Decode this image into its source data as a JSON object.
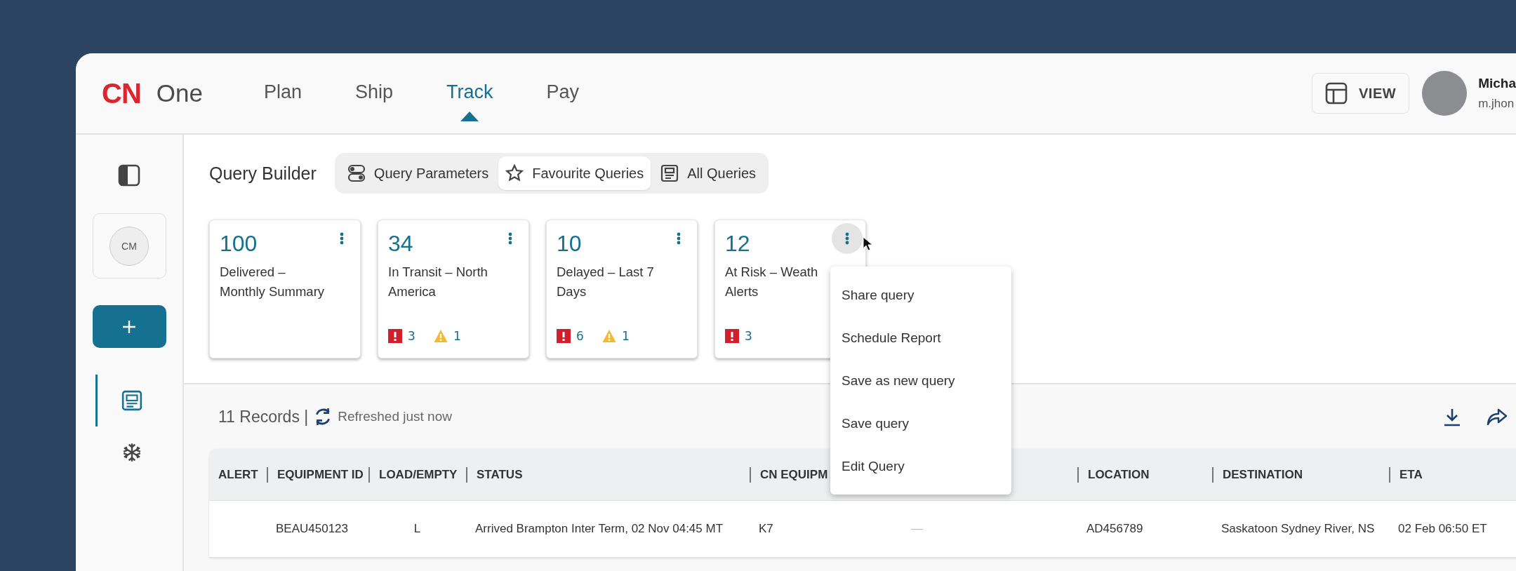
{
  "brand": {
    "logo": "CN",
    "name": "One"
  },
  "nav": [
    {
      "label": "Plan",
      "selected": false
    },
    {
      "label": "Ship",
      "selected": false
    },
    {
      "label": "Track",
      "selected": true
    },
    {
      "label": "Pay",
      "selected": false
    }
  ],
  "view_button": {
    "label": "VIEW"
  },
  "user": {
    "name": "Micha",
    "email": "m.jhon"
  },
  "sidebar": {
    "avatar_initials": "CM",
    "items": [
      {
        "kind": "queries",
        "selected": true
      },
      {
        "kind": "snowflake",
        "selected": false
      }
    ]
  },
  "query_builder": {
    "title": "Query Builder",
    "tabs": [
      {
        "kind": "parameters",
        "label": "Query Parameters",
        "selected": false
      },
      {
        "kind": "favourite",
        "label": "Favourite Queries",
        "selected": true
      },
      {
        "kind": "all",
        "label": "All Queries",
        "selected": false
      }
    ]
  },
  "query_cards": [
    {
      "count": "100",
      "title": "Delivered – Monthly Summary",
      "menu_open": false
    },
    {
      "count": "34",
      "title": "In Transit – North America",
      "alerts": [
        {
          "kind": "error",
          "count": "3"
        },
        {
          "kind": "warning",
          "count": "1"
        }
      ],
      "menu_open": false
    },
    {
      "count": "10",
      "title": "Delayed – Last 7 Days",
      "alerts": [
        {
          "kind": "error",
          "count": "6"
        },
        {
          "kind": "warning",
          "count": "1"
        }
      ],
      "menu_open": false
    },
    {
      "count": "12",
      "title": "At Risk – Weath Alerts",
      "alerts": [
        {
          "kind": "error",
          "count": "3"
        }
      ],
      "menu_open": true
    }
  ],
  "context_menu": [
    "Share query",
    "Schedule Report",
    "Save as new query",
    "Save query",
    "Edit Query"
  ],
  "records": {
    "count": "11 Records |",
    "refresh": "Refreshed just now"
  },
  "table": {
    "columns": [
      {
        "label": "ALERT"
      },
      {
        "label": "EQUIPMENT ID"
      },
      {
        "label": "LOAD/EMPTY"
      },
      {
        "label": "STATUS"
      },
      {
        "label": "CN EQUIPM"
      },
      {},
      {
        "label": "LOCATION"
      },
      {
        "label": "DESTINATION"
      },
      {
        "label": "ETA"
      }
    ],
    "rows": [
      {
        "cells": [
          "",
          "BEAU450123",
          "L",
          "Arrived Brampton Inter Term, 02 Nov 04:45 MT",
          "K7",
          "—",
          "AD456789",
          "Saskatoon Sydney River, NS",
          "02 Feb 06:50 ET"
        ]
      }
    ]
  }
}
